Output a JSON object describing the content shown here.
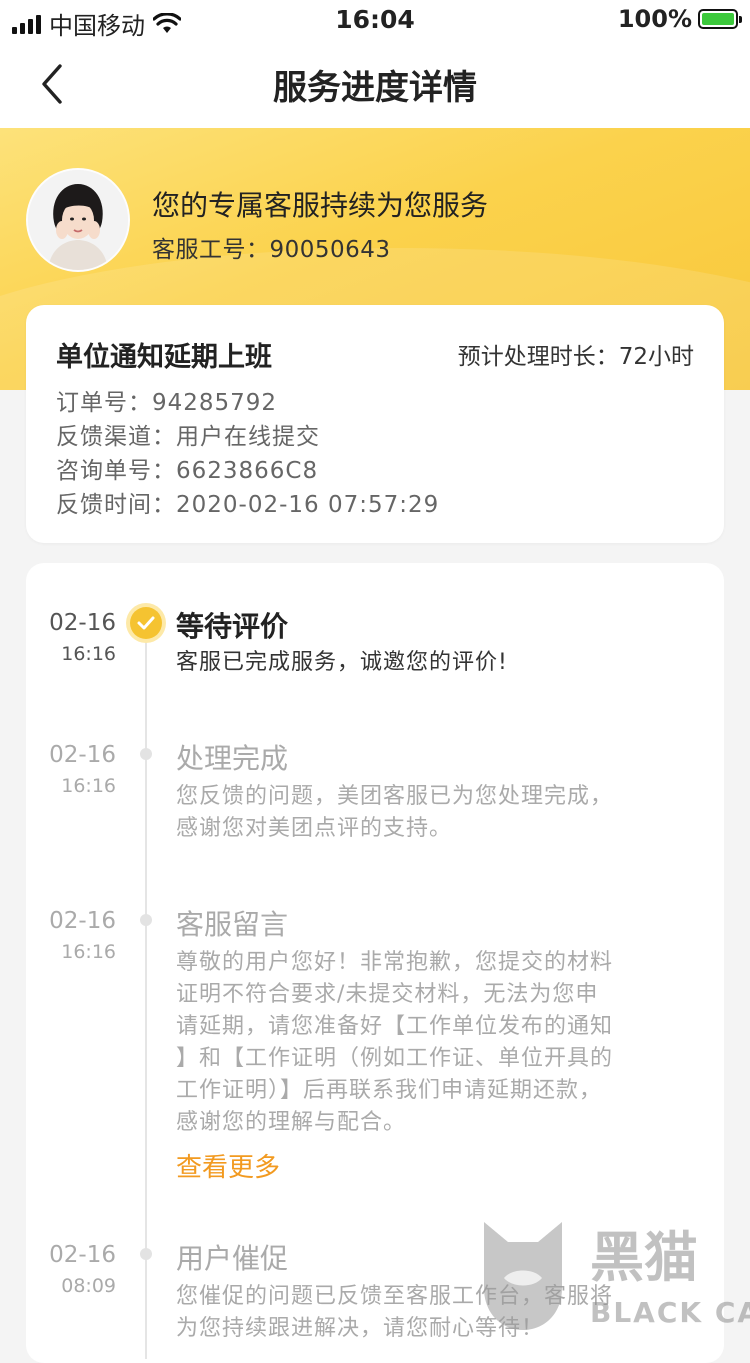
{
  "status_bar": {
    "carrier": "中国移动",
    "time": "16:04",
    "battery": "100%"
  },
  "nav": {
    "title": "服务进度详情"
  },
  "agent": {
    "headline": "您的专属客服持续为您服务",
    "id_line": "客服工号：90050643"
  },
  "order": {
    "title": "单位通知延期上班",
    "eta": "预计处理时长：72小时",
    "rows": [
      "订单号：94285792",
      "反馈渠道：用户在线提交",
      "咨询单号：6623866C8",
      "反馈时间：2020-02-16 07:57:29"
    ]
  },
  "timeline": [
    {
      "date": "02-16",
      "time": "16:16",
      "title": "等待评价",
      "lines": [
        "客服已完成服务，诚邀您的评价!"
      ]
    },
    {
      "date": "02-16",
      "time": "16:16",
      "title": "处理完成",
      "lines": [
        "您反馈的问题，美团客服已为您处理完成，",
        "感谢您对美团点评的支持。"
      ]
    },
    {
      "date": "02-16",
      "time": "16:16",
      "title": "客服留言",
      "lines": [
        "尊敬的用户您好！非常抱歉，您提交的材料",
        "证明不符合要求/未提交材料，无法为您申",
        "请延期，请您准备好【工作单位发布的通知",
        "】和【工作证明（例如工作证、单位开具的",
        "工作证明）】后再联系我们申请延期还款，",
        "感谢您的理解与配合。"
      ],
      "more": "查看更多"
    },
    {
      "date": "02-16",
      "time": "08:09",
      "title": "用户催促",
      "lines": [
        "您催促的问题已反馈至客服工作台，客服将",
        "为您持续跟进解决，请您耐心等待！"
      ]
    }
  ],
  "watermark": {
    "cn": "黑猫",
    "en": "BLACK CAT"
  },
  "colors": {
    "accent": "#f5c331",
    "link": "#f29a20",
    "header_yellow": "#fbd24c"
  }
}
